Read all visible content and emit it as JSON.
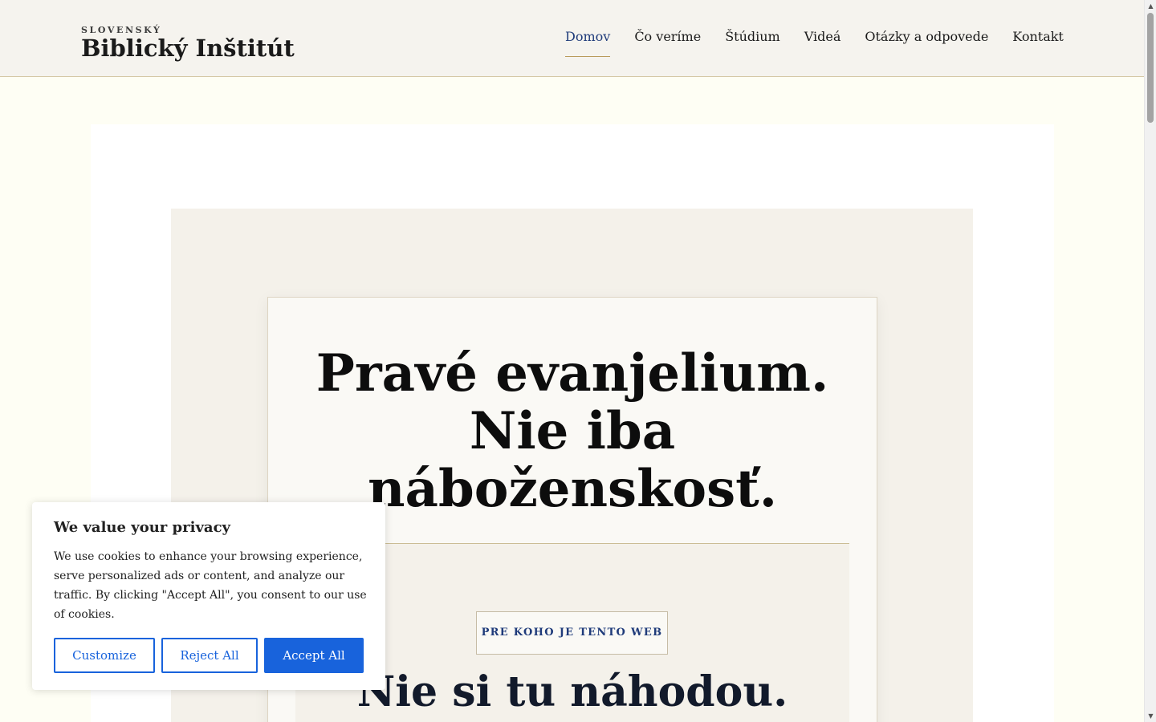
{
  "header": {
    "brand_small": "SLOVENSKÝ",
    "brand_name": "Biblický Inštitút",
    "nav": [
      {
        "label": "Domov",
        "active": true
      },
      {
        "label": "Čo veríme",
        "active": false
      },
      {
        "label": "Štúdium",
        "active": false
      },
      {
        "label": "Videá",
        "active": false
      },
      {
        "label": "Otázky a odpovede",
        "active": false
      },
      {
        "label": "Kontakt",
        "active": false
      }
    ]
  },
  "hero": {
    "title_lines": [
      "Pravé evanjelium.",
      "Nie iba",
      "náboženskosť."
    ],
    "tag": "PRE KOHO JE TENTO WEB",
    "subtitle": "Nie si tu náhodou."
  },
  "cookie": {
    "title": "We value your privacy",
    "text": "We use cookies to enhance your browsing experience, serve personalized ads or content, and analyze our traffic. By clicking \"Accept All\", you consent to our use of cookies.",
    "customize_label": "Customize",
    "reject_label": "Reject All",
    "accept_label": "Accept All"
  },
  "colors": {
    "accent_blue": "#1863dc",
    "nav_active": "#1f3b7a",
    "gold_underline": "#b89a5a",
    "header_bg": "#f5f3ee",
    "page_bg": "#fefef4",
    "section_bg": "#f4f1ea"
  },
  "scrollbar": {
    "up_icon": "arrow-up-icon",
    "down_icon": "arrow-down-icon"
  }
}
